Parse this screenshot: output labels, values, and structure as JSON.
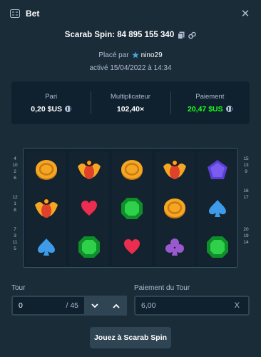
{
  "header": {
    "title": "Bet",
    "icon": "bet-slip-icon",
    "close": "✕"
  },
  "game": {
    "title": "Scarab Spin: 84 895 155 340",
    "copy_icon": "copy-icon",
    "link_icon": "link-icon"
  },
  "placed": {
    "prefix": "Placé par",
    "user": "nino29",
    "user_icon": "star-badge-icon"
  },
  "activated": "activé 15/04/2022 à 14:34",
  "stats": [
    {
      "label": "Pari",
      "value": "0,20 $US",
      "coin": true
    },
    {
      "label": "Multiplicateur",
      "value": "102,40×",
      "coin": false
    },
    {
      "label": "Paiement",
      "value": "20,47 $US",
      "coin": true,
      "color": "#1fff20"
    }
  ],
  "reels": [
    [
      "coin",
      "scarab",
      "spade"
    ],
    [
      "scarab",
      "heart",
      "emerald"
    ],
    [
      "coin",
      "emerald",
      "heart"
    ],
    [
      "scarab",
      "coin",
      "club"
    ],
    [
      "pentagon",
      "spade",
      "emerald"
    ]
  ],
  "paylines": {
    "left": [
      "4",
      "10",
      "2",
      "6",
      "",
      "",
      "12",
      "1",
      "8",
      "",
      "",
      "7",
      "3",
      "11",
      "5"
    ],
    "right": [
      "15",
      "13",
      "9",
      "",
      "",
      "16",
      "17",
      "",
      "",
      "",
      "",
      "20",
      "19",
      "14",
      ""
    ]
  },
  "round": {
    "label": "Tour",
    "value": "0",
    "total": "/ 45"
  },
  "round_payout": {
    "label": "Paiement du Tour",
    "value": "6,00",
    "clear": "X"
  },
  "play_button": "Jouez à Scarab Spin",
  "colors": {
    "background": "#1a2c38",
    "panel": "#0f212e",
    "button": "#2f4553",
    "win": "#1fff20"
  }
}
